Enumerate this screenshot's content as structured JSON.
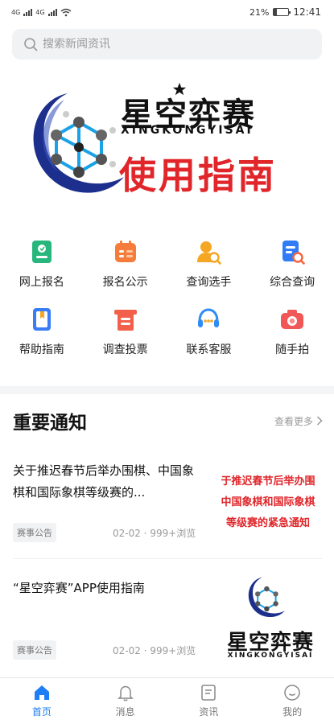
{
  "status_bar": {
    "network_1": "4G",
    "network_2": "4G",
    "battery_percent": "21%",
    "battery_level": 0.21,
    "time": "12:41"
  },
  "search": {
    "placeholder": "搜索新闻资讯"
  },
  "banner": {
    "title": "星空弈赛",
    "pinyin": "XINGKONGYISAI",
    "subtitle": "使用指南"
  },
  "quick_links": [
    {
      "label": "网上报名",
      "icon": "registration-icon",
      "color": "#27b77c"
    },
    {
      "label": "报名公示",
      "icon": "calendar-list-icon",
      "color": "#f57c3a"
    },
    {
      "label": "查询选手",
      "icon": "user-search-icon",
      "color": "#f5a623"
    },
    {
      "label": "综合查询",
      "icon": "document-search-icon",
      "color": "#2f7cf6"
    },
    {
      "label": "帮助指南",
      "icon": "book-icon",
      "color": "#3a7cf3"
    },
    {
      "label": "调查投票",
      "icon": "ballot-icon",
      "color": "#f2604b"
    },
    {
      "label": "联系客服",
      "icon": "headset-icon",
      "color": "#2f8cf5"
    },
    {
      "label": "随手拍",
      "icon": "camera-icon",
      "color": "#f25757"
    }
  ],
  "notices": {
    "title": "重要通知",
    "more_label": "查看更多",
    "items": [
      {
        "title": "关于推迟春节后举办围棋、中国象棋和国际象棋等级赛的...",
        "tag": "赛事公告",
        "meta": "02-02 · 999+浏览",
        "thumb_lines": [
          "于推迟春节后举办围",
          "中国象棋和国际象棋",
          "等级赛的紧急通知"
        ]
      },
      {
        "title": "“星空弈赛”APP使用指南",
        "tag": "赛事公告",
        "meta": "02-02 · 999+浏览",
        "thumb_title": "星空弈赛",
        "thumb_pinyin": "XINGKONGYISAI"
      }
    ]
  },
  "tabbar": [
    {
      "label": "首页",
      "icon": "home-icon",
      "active": true
    },
    {
      "label": "消息",
      "icon": "bell-icon",
      "active": false
    },
    {
      "label": "资讯",
      "icon": "news-icon",
      "active": false
    },
    {
      "label": "我的",
      "icon": "profile-icon",
      "active": false
    }
  ],
  "colors": {
    "accent": "#1e7ef5",
    "brand_red": "#e0262a",
    "brand_navy": "#1d2f8c"
  }
}
